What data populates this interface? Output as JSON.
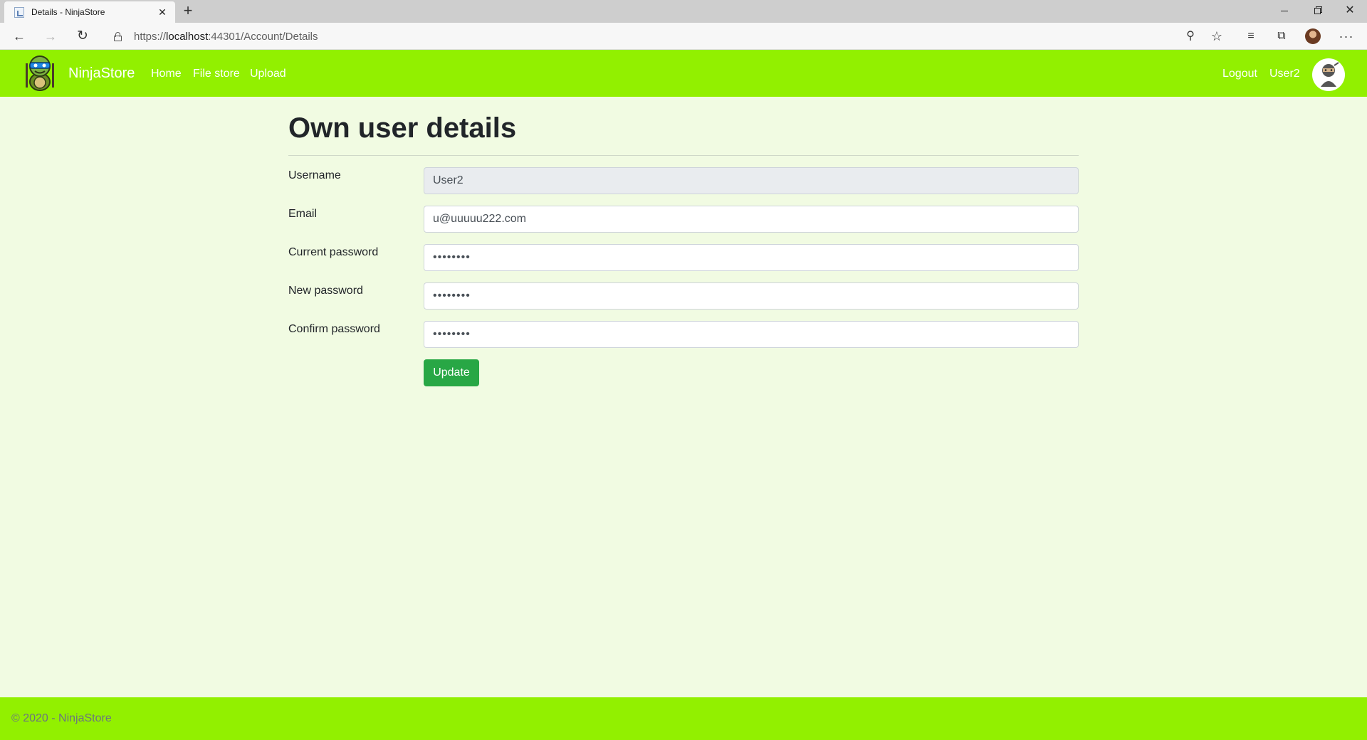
{
  "browser": {
    "tab_title": "Details - NinjaStore",
    "url_prefix": "https://",
    "url_host": "localhost",
    "url_rest": ":44301/Account/Details"
  },
  "navbar": {
    "brand": "NinjaStore",
    "links": [
      "Home",
      "File store",
      "Upload"
    ],
    "logout": "Logout",
    "user": "User2",
    "color": "#92f000"
  },
  "page": {
    "title": "Own user details"
  },
  "form": {
    "username": {
      "label": "Username",
      "value": "User2"
    },
    "email": {
      "label": "Email",
      "value": "u@uuuuu222.com"
    },
    "current_password": {
      "label": "Current password",
      "value": "••••••••"
    },
    "new_password": {
      "label": "New password",
      "value": "••••••••"
    },
    "confirm_password": {
      "label": "Confirm password",
      "value": "••••••••"
    },
    "submit": "Update",
    "submit_color": "#28a745"
  },
  "footer": {
    "text": "© 2020 - NinjaStore"
  }
}
